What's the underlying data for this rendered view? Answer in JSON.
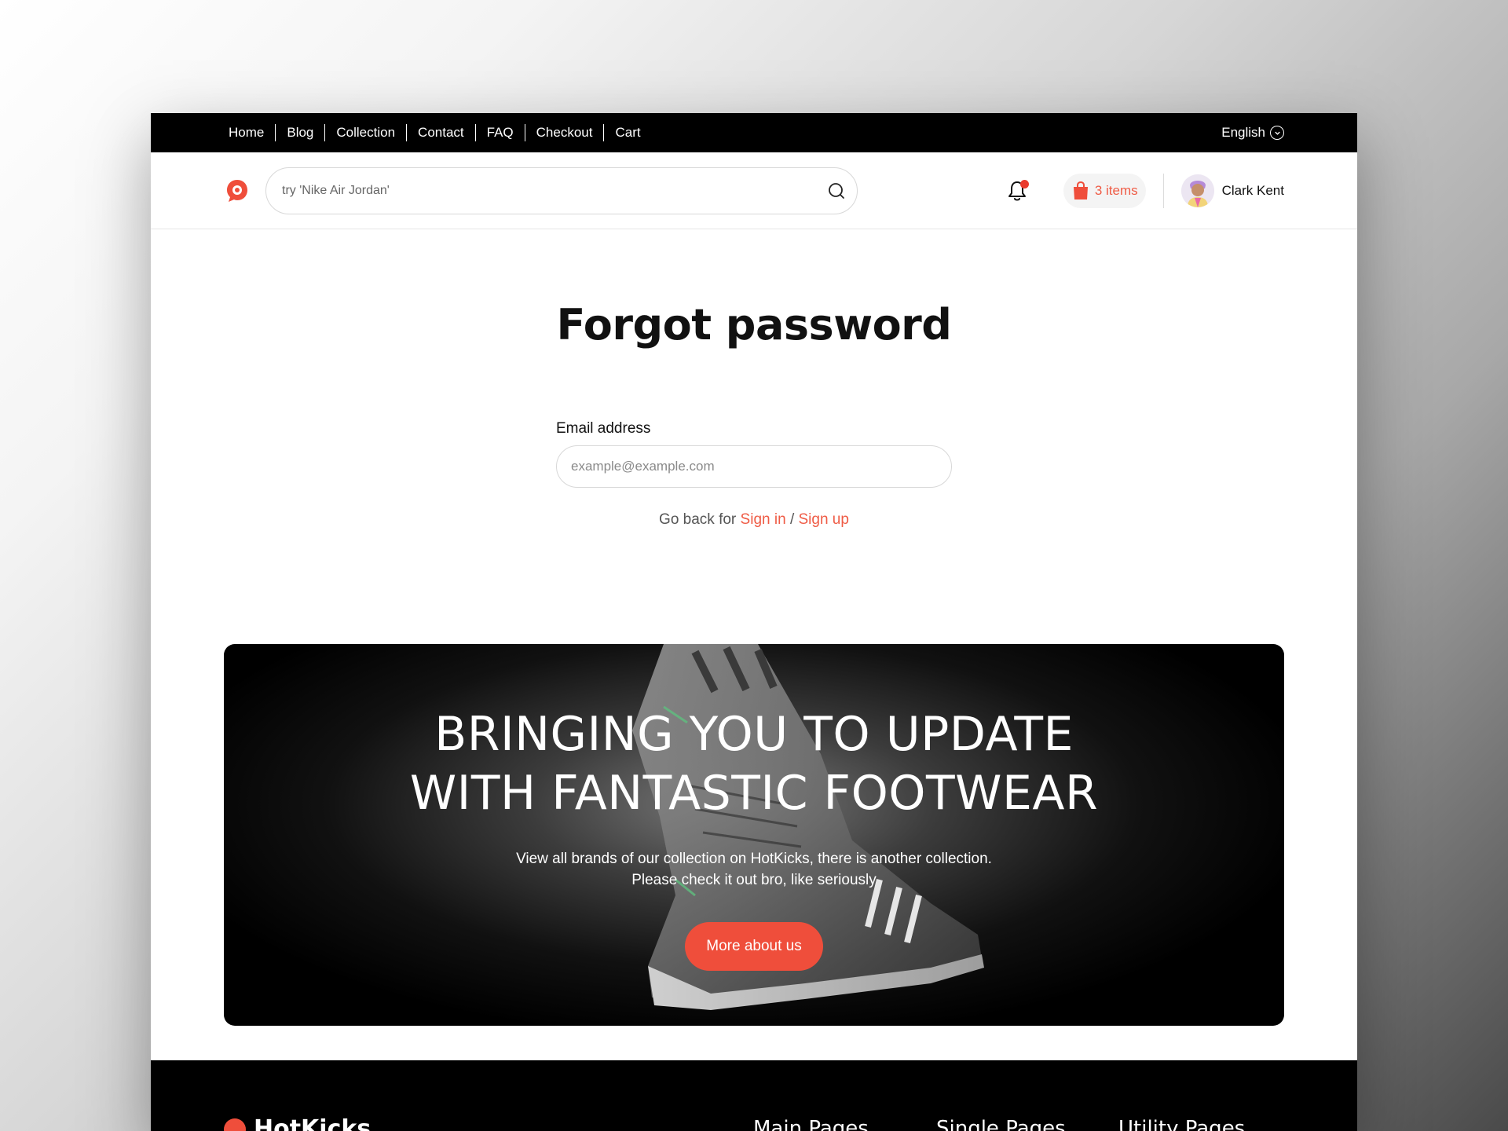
{
  "topbar": {
    "nav": [
      "Home",
      "Blog",
      "Collection",
      "Contact",
      "FAQ",
      "Checkout",
      "Cart"
    ],
    "language": "English"
  },
  "header": {
    "search_placeholder": "try 'Nike Air Jordan'",
    "cart_label": "3 items",
    "user_name": "Clark Kent"
  },
  "main": {
    "title": "Forgot password",
    "email_label": "Email address",
    "email_placeholder": "example@example.com",
    "goback_prefix": "Go back for",
    "sign_in": "Sign in",
    "separator": "/",
    "sign_up": "Sign up"
  },
  "banner": {
    "title_line1": "BRINGING YOU TO UPDATE",
    "title_line2": "WITH FANTASTIC FOOTWEAR",
    "subtitle_line1": "View all brands of our collection on HotKicks, there is another collection.",
    "subtitle_line2": "Please check it out bro, like seriously",
    "button_label": "More about us"
  },
  "footer": {
    "brand": "HotKicks",
    "columns": [
      "Main Pages",
      "Single Pages",
      "Utility Pages"
    ]
  },
  "colors": {
    "accent": "#ef4e3b",
    "notification_dot": "#ea3b2e",
    "topbar_bg": "#000000"
  },
  "icons": {
    "logo": "hotkicks-logo-icon",
    "search": "search-icon",
    "bell": "bell-icon",
    "cart": "shopping-bag-icon",
    "language": "chevron-down-icon"
  }
}
